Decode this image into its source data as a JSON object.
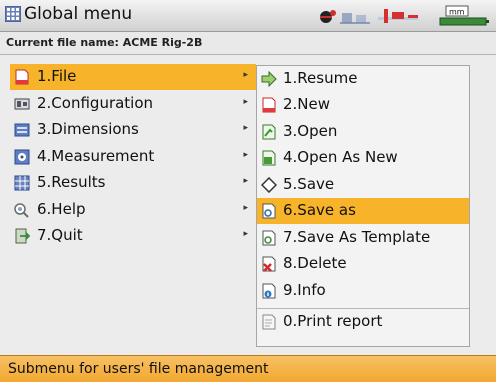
{
  "window": {
    "title": "Global menu",
    "title_icon": "grid-menu-icon",
    "status_icons": [
      "rotor-icon",
      "machine-train-icon",
      "alignment-laser-icon",
      "unit-mm-icon",
      "battery-icon"
    ],
    "unit_badge": "mm"
  },
  "file_info": {
    "text": "Current file name: ACME Rig-2B"
  },
  "main_menu": {
    "items": [
      {
        "label": "1.File",
        "icon": "file-icon",
        "selected": true
      },
      {
        "label": "2.Configuration",
        "icon": "configuration-icon",
        "selected": false
      },
      {
        "label": "3.Dimensions",
        "icon": "dimensions-icon",
        "selected": false
      },
      {
        "label": "4.Measurement",
        "icon": "measurement-icon",
        "selected": false
      },
      {
        "label": "5.Results",
        "icon": "results-icon",
        "selected": false
      },
      {
        "label": "6.Help",
        "icon": "help-icon",
        "selected": false
      },
      {
        "label": "7.Quit",
        "icon": "quit-icon",
        "selected": false
      }
    ]
  },
  "submenu": {
    "items": [
      {
        "label": "1.Resume",
        "icon": "resume-arrow-icon",
        "selected": false
      },
      {
        "label": "2.New",
        "icon": "new-file-icon",
        "selected": false
      },
      {
        "label": "3.Open",
        "icon": "open-file-icon",
        "selected": false
      },
      {
        "label": "4.Open As New",
        "icon": "open-as-new-icon",
        "selected": false
      },
      {
        "label": "5.Save",
        "icon": "save-diamond-icon",
        "selected": false
      },
      {
        "label": "6.Save as",
        "icon": "save-as-icon",
        "selected": true
      },
      {
        "label": "7.Save As Template",
        "icon": "save-template-icon",
        "selected": false
      },
      {
        "label": "8.Delete",
        "icon": "delete-icon",
        "selected": false
      },
      {
        "label": "9.Info",
        "icon": "info-icon",
        "selected": false
      },
      {
        "label": "0.Print report",
        "icon": "print-report-icon",
        "selected": false
      }
    ]
  },
  "status": {
    "text": "Submenu for users' file management"
  },
  "colors": {
    "highlight": "#f7b42a",
    "status_bar": "#f2a830",
    "background": "#ececec"
  }
}
